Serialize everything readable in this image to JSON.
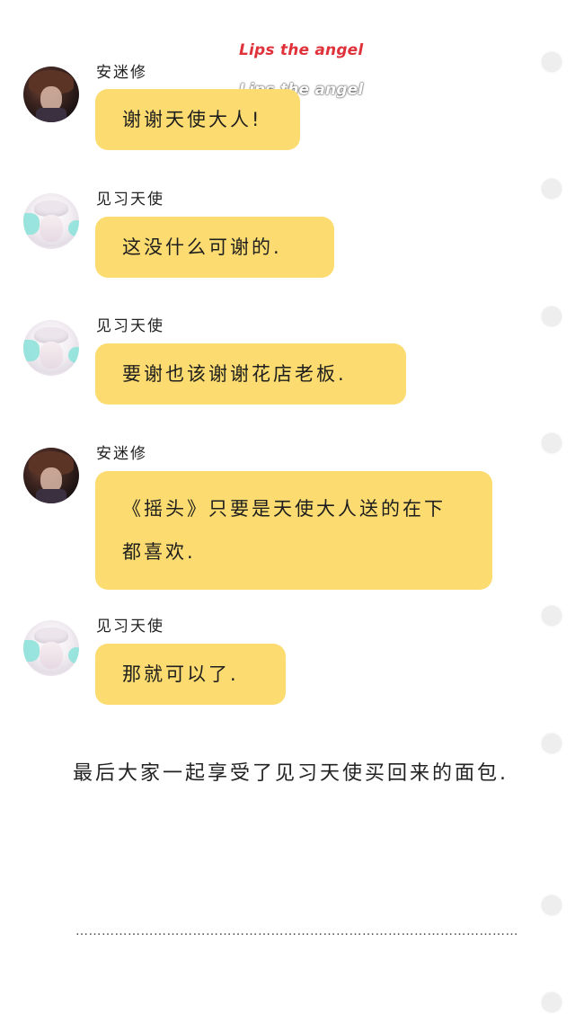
{
  "music": {
    "title_red": "Lips the angel",
    "title_white": "Lips the angel"
  },
  "messages": [
    {
      "sender": "安迷修",
      "text": "谢谢天使大人!"
    },
    {
      "sender": "见习天使",
      "text": "这没什么可谢的."
    },
    {
      "sender": "见习天使",
      "text": "要谢也该谢谢花店老板."
    },
    {
      "sender": "安迷修",
      "text": "《摇头》只要是天使大人送的在下都喜欢."
    },
    {
      "sender": "见习天使",
      "text": "那就可以了."
    }
  ],
  "narration": "最后大家一起享受了见习天使买回来的面包.",
  "separator": "…………………………………………………………………………………………"
}
